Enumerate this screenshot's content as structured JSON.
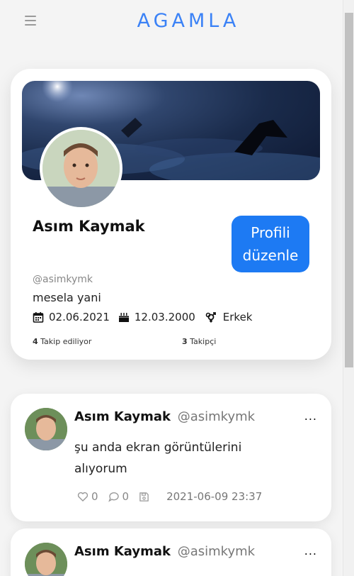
{
  "app": {
    "brand": "AGAMLA"
  },
  "profile": {
    "name": "Asım Kaymak",
    "handle": "@asimkymk",
    "bio": "mesela yani",
    "joined": "02.06.2021",
    "birthday": "12.03.2000",
    "gender": "Erkek",
    "edit_label": "Profili düzenle",
    "following_count": "4",
    "following_label": "Takip ediliyor",
    "followers_count": "3",
    "followers_label": "Takipçi"
  },
  "posts": [
    {
      "author": "Asım Kaymak",
      "handle": "@asimkymk",
      "more": "...",
      "text": "şu anda ekran görüntülerini alıyorum",
      "likes": "0",
      "comments": "0",
      "timestamp": "2021-06-09 23:37"
    },
    {
      "author": "Asım Kaymak",
      "handle": "@asimkymk",
      "more": "..."
    }
  ],
  "colors": {
    "accent": "#1d7af3",
    "brand": "#3b82f6"
  },
  "icons": [
    "menu-icon",
    "calendar-icon",
    "cake-icon",
    "gender-icon",
    "heart-icon",
    "comment-icon",
    "save-icon",
    "more-icon"
  ]
}
